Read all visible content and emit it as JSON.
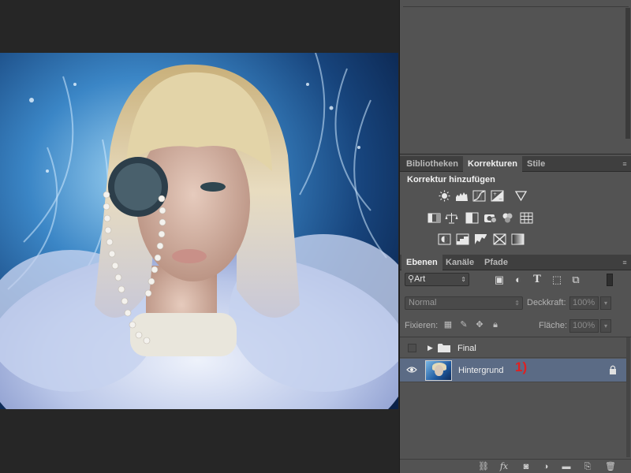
{
  "canvas": {
    "image_label": "portrait photo"
  },
  "panels": {
    "top_tabs": [
      {
        "label": "Bibliotheken",
        "active": false
      },
      {
        "label": "Korrekturen",
        "active": true
      },
      {
        "label": "Stile",
        "active": false
      }
    ],
    "corrections": {
      "title": "Korrektur hinzufügen",
      "rows": [
        [
          "brightness-contrast-icon",
          "levels-icon",
          "curves-icon",
          "exposure-icon",
          "vibrance-icon"
        ],
        [
          "hue-saturation-icon",
          "color-balance-icon",
          "black-white-icon",
          "photo-filter-icon",
          "channel-mixer-icon",
          "color-lookup-icon"
        ],
        [
          "invert-icon",
          "posterize-icon",
          "threshold-icon",
          "selective-color-icon",
          "gradient-map-icon"
        ]
      ]
    },
    "layers_tabs": [
      {
        "label": "Ebenen",
        "active": true
      },
      {
        "label": "Kanäle",
        "active": false
      },
      {
        "label": "Pfade",
        "active": false
      }
    ],
    "layers": {
      "filter_type": "Art",
      "blend_mode": "Normal",
      "opacity_label": "Deckkraft:",
      "opacity_value": "100%",
      "lock_label": "Fixieren:",
      "fill_label": "Fläche:",
      "fill_value": "100%",
      "items": [
        {
          "name": "Final",
          "type": "group",
          "visible": false
        },
        {
          "name": "Hintergrund",
          "type": "image",
          "visible": true,
          "locked": true,
          "annotation": "1)"
        }
      ]
    }
  },
  "colors": {
    "selected_layer": "#5b6b85",
    "annotation": "#e02020",
    "panel_bg": "#535353",
    "canvas_bg": "#262626"
  }
}
